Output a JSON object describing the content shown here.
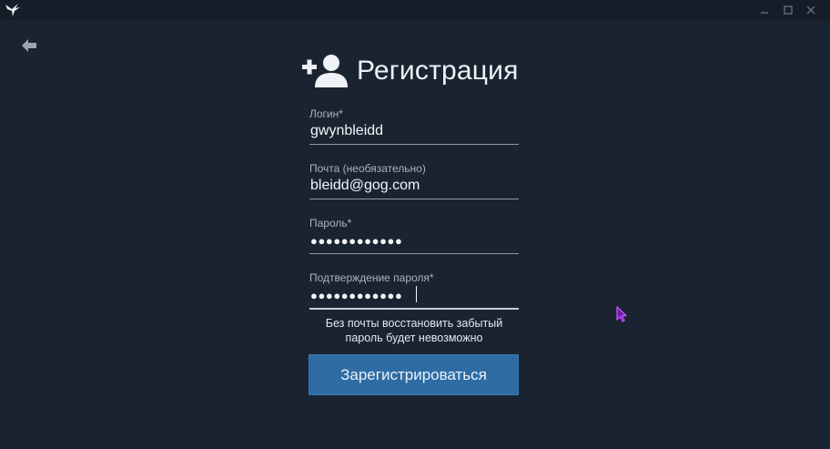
{
  "app": {
    "logo_icon": "bird-icon",
    "window_controls": [
      "minimize-icon",
      "maximize-icon",
      "close-icon"
    ]
  },
  "nav": {
    "back_icon": "arrow-left-icon"
  },
  "form": {
    "title": "Регистрация",
    "title_icon": "add-user-icon",
    "fields": [
      {
        "label": "Логин*",
        "value": "gwynbleidd",
        "type": "text"
      },
      {
        "label": "Почта (необязательно)",
        "value": "bleidd@gog.com",
        "type": "email"
      },
      {
        "label": "Пароль*",
        "value": "●●●●●●●●●●●●",
        "type": "password"
      },
      {
        "label": "Подтверждение пароля*",
        "value": "●●●●●●●●●●●●",
        "type": "password"
      }
    ],
    "hint_line1": "Без почты восстановить забытый",
    "hint_line2": "пароль будет невозможно",
    "submit_label": "Зарегистрироваться"
  },
  "colors": {
    "background": "#1a2431",
    "titlebar": "#151d28",
    "button": "#2e6ca3",
    "cursor_accent": "#b43cf0"
  }
}
